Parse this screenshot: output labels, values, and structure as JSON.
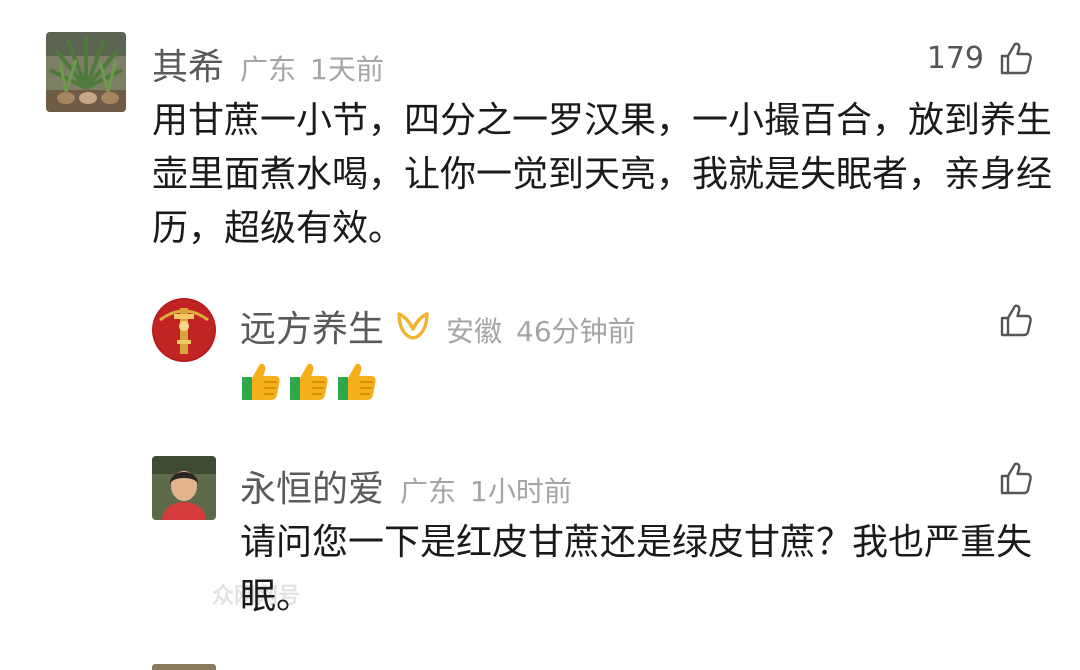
{
  "comments": [
    {
      "username": "其希",
      "location": "广东",
      "time": "1天前",
      "likes": "179",
      "text": "用甘蔗一小节，四分之一罗汉果，一小撮百合，放到养生壶里面煮水喝，让你一觉到天亮，我就是失眠者，亲身经历，超级有效。"
    },
    {
      "username": "远方养生",
      "location": "安徽",
      "time": "46分钟前",
      "badge_icon": "verified-badge-icon",
      "reaction_icons": [
        "thumbs-up-emoji",
        "thumbs-up-emoji",
        "thumbs-up-emoji"
      ]
    },
    {
      "username": "永恒的爱",
      "location": "广东",
      "time": "1小时前",
      "text": "请问您一下是红皮甘蔗还是绿皮甘蔗？我也严重失眠。"
    }
  ],
  "watermark": "众网网号",
  "colors": {
    "username": "#5a5a5a",
    "meta": "#a5a5a5",
    "body": "#1a1a1a",
    "like_icon": "#555555",
    "badge": "#f2b233"
  }
}
